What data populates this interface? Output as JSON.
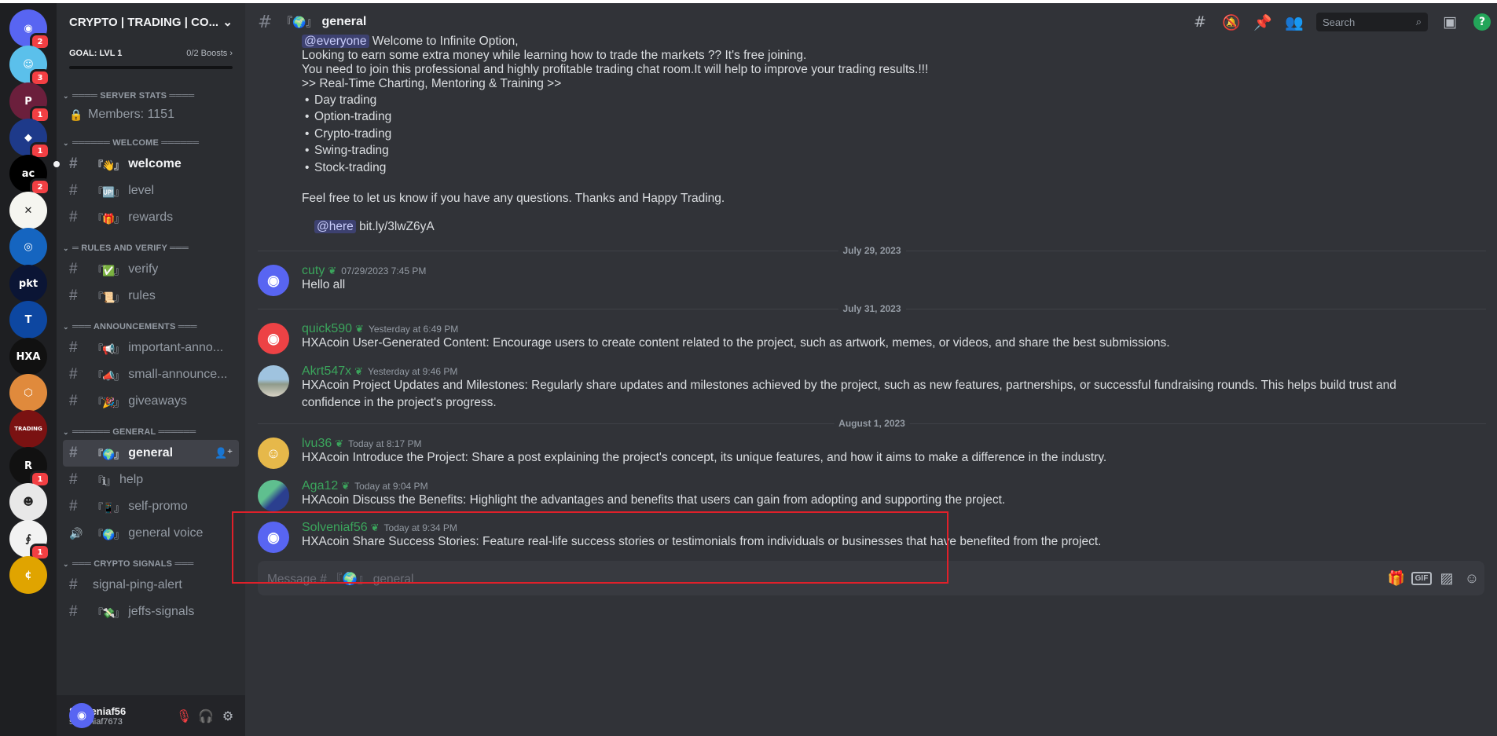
{
  "servers": [
    {
      "glyph": "◉",
      "bg": "#5865f2",
      "badge": "2",
      "icon": "discord-home-icon"
    },
    {
      "glyph": "☺",
      "bg": "#5bc0eb",
      "badge": "3",
      "icon": "smiley-server-icon"
    },
    {
      "glyph": "P",
      "bg": "#6b1f3c",
      "badge": "1",
      "icon": "p-server-icon"
    },
    {
      "glyph": "◆",
      "bg": "#1e3a8a",
      "badge": "1",
      "icon": "diamond-server-icon"
    },
    {
      "glyph": "ac",
      "bg": "#000000",
      "badge": "2",
      "icon": "ac-server-icon"
    },
    {
      "glyph": "✕",
      "bg": "#f5f5f0",
      "badge": "",
      "icon": "x-server-icon"
    },
    {
      "glyph": "◎",
      "bg": "#1565c0",
      "badge": "",
      "icon": "circle-server-icon"
    },
    {
      "glyph": "pkt",
      "bg": "#0b1535",
      "badge": "",
      "icon": "pkt-server-icon"
    },
    {
      "glyph": "T",
      "bg": "#0d47a1",
      "badge": "",
      "icon": "t-server-icon"
    },
    {
      "glyph": "HXA",
      "bg": "#111111",
      "badge": "",
      "icon": "hxa-server-icon"
    },
    {
      "glyph": "⬡",
      "bg": "#e08a3c",
      "badge": "",
      "icon": "hex-server-icon"
    },
    {
      "glyph": "TRADING",
      "bg": "#7a1212",
      "badge": "",
      "icon": "trading-server-icon"
    },
    {
      "glyph": "R",
      "bg": "#111111",
      "badge": "1",
      "icon": "r-server-icon"
    },
    {
      "glyph": "☻",
      "bg": "#e8e8e8",
      "badge": "",
      "icon": "mascot-server-icon"
    },
    {
      "glyph": "∮",
      "bg": "#f2f2f2",
      "badge": "1",
      "icon": "s-server-icon"
    },
    {
      "glyph": "¢",
      "bg": "#e0a400",
      "badge": "",
      "icon": "coin-server-icon"
    }
  ],
  "server": {
    "name": "CRYPTO | TRADING | CO...",
    "goal": "GOAL: LVL 1",
    "boosts": "0/2 Boosts"
  },
  "categories": [
    {
      "name": "════ SERVER STATS ════",
      "channels": [
        {
          "type": "lock",
          "emoji": "",
          "name": "Members: 1151",
          "state": "static"
        }
      ]
    },
    {
      "name": "══════ WELCOME ══════",
      "channels": [
        {
          "type": "hash",
          "emoji": "『👋』",
          "name": "welcome",
          "state": "unread"
        },
        {
          "type": "hash",
          "emoji": "『🆙』",
          "name": "level",
          "state": ""
        },
        {
          "type": "hash",
          "emoji": "『🎁』",
          "name": "rewards",
          "state": ""
        }
      ]
    },
    {
      "name": "═ RULES AND VERIFY ═══",
      "channels": [
        {
          "type": "hash",
          "emoji": "『✅』",
          "name": "verify",
          "state": ""
        },
        {
          "type": "hash",
          "emoji": "『📜』",
          "name": "rules",
          "state": ""
        }
      ]
    },
    {
      "name": "═══ ANNOUNCEMENTS ═══",
      "channels": [
        {
          "type": "hash",
          "emoji": "『📢』",
          "name": "important-anno...",
          "state": ""
        },
        {
          "type": "hash",
          "emoji": "『📣』",
          "name": "small-announce...",
          "state": ""
        },
        {
          "type": "hash",
          "emoji": "『🎉』",
          "name": "giveaways",
          "state": ""
        }
      ]
    },
    {
      "name": "══════ GENERAL ══════",
      "channels": [
        {
          "type": "hash",
          "emoji": "『🌍』",
          "name": "general",
          "state": "selected"
        },
        {
          "type": "hash",
          "emoji": "『ℹ』",
          "name": "help",
          "state": ""
        },
        {
          "type": "hash",
          "emoji": "『📱』",
          "name": "self-promo",
          "state": ""
        },
        {
          "type": "voice",
          "emoji": "『🌍』",
          "name": "general voice",
          "state": ""
        }
      ]
    },
    {
      "name": "═══ CRYPTO SIGNALS ═══",
      "channels": [
        {
          "type": "hash",
          "emoji": "",
          "name": "signal-ping-alert",
          "state": ""
        },
        {
          "type": "hash",
          "emoji": "『💸』",
          "name": "jeffs-signals",
          "state": ""
        }
      ]
    }
  ],
  "user": {
    "display_name": "Solveniaf56",
    "username": "solveniaf7673"
  },
  "channel": {
    "emoji": "『🌍』",
    "title": "general"
  },
  "search": {
    "placeholder": "Search"
  },
  "intro": {
    "mention_everyone": "@everyone",
    "line1": " Welcome to Infinite Option,",
    "line2": "Looking to earn some extra money while learning how to trade the markets ??  It's free joining.",
    "line3": "You need to join this professional and highly profitable trading chat room.It will help to improve your trading results.!!!",
    "line4": ">> Real-Time Charting, Mentoring & Training >>",
    "bullets": [
      "Day trading",
      "Option-trading",
      "Crypto-trading",
      "Swing-trading",
      "Stock-trading"
    ],
    "line5": "Feel free to let us know if you have any questions. Thanks and Happy Trading.",
    "mention_here": "@here",
    "link": "bit.ly/3lwZ6yA"
  },
  "dividers": {
    "d1": "July 29, 2023",
    "d2": "July 31, 2023",
    "d3": "August 1, 2023"
  },
  "messages": [
    {
      "author": "cuty",
      "time": "07/29/2023 7:45 PM",
      "text": "Hello all"
    },
    {
      "author": "quick590",
      "time": "Yesterday at 6:49 PM",
      "text": "HXAcoin User-Generated Content: Encourage users to create content related to the project, such as artwork, memes, or videos, and share the best submissions."
    },
    {
      "author": "Akrt547x",
      "time": "Yesterday at 9:46 PM",
      "text": "HXAcoin Project Updates and Milestones: Regularly share updates and milestones achieved by the project, such as new features, partnerships, or successful fundraising rounds. This helps build trust and confidence in the project's progress."
    },
    {
      "author": "lvu36",
      "time": "Today at 8:17 PM",
      "text": "HXAcoin Introduce the Project: Share a post explaining the project's concept, its unique features, and how it aims to make a difference in the industry."
    },
    {
      "author": "Aga12",
      "time": "Today at 9:04 PM",
      "text": "HXAcoin Discuss the Benefits: Highlight the advantages and benefits that users can gain from adopting and supporting the project."
    },
    {
      "author": "Solveniaf56",
      "time": "Today at 9:34 PM",
      "text": "HXAcoin Share Success Stories: Feature real-life success stories or testimonials from individuals or businesses that have benefited from the project."
    }
  ],
  "composer": {
    "placeholder": "Message # 『🌍』 general",
    "gif_label": "GIF"
  },
  "colors": {
    "rail_bg": "#1e1f22",
    "sidebar_bg": "#2b2d31",
    "chat_bg": "#313338",
    "author_green": "#3ba55c",
    "badge_red": "#f23f43",
    "highlight_box": "#e0202a"
  }
}
